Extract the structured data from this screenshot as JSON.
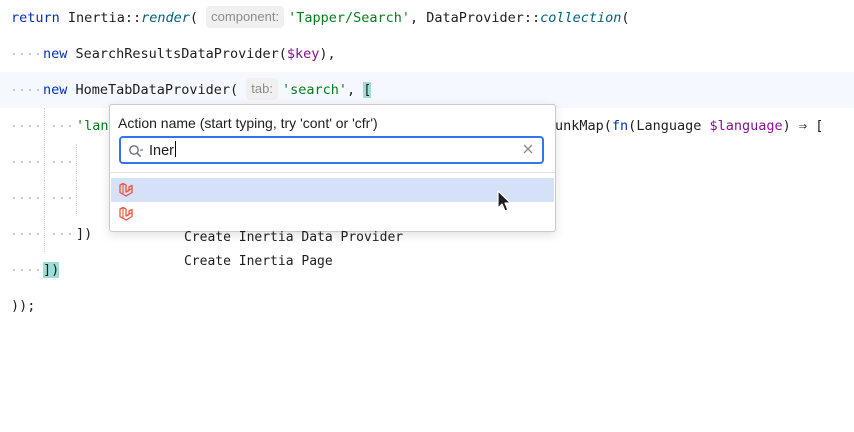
{
  "editor": {
    "line1": {
      "kw_return": "return",
      "class_inertia": "Inertia",
      "op1": "::",
      "fn_render": "render",
      "paren_open": "(",
      "hint_component": "component:",
      "str_tapper": "'Tapper/Search'",
      "comma": ",",
      "class_dataprovider": "DataProvider",
      "op2": "::",
      "fn_collection": "collection",
      "paren_open2": "("
    },
    "line2": {
      "kw_new": "new",
      "class": "SearchResultsDataProvider",
      "paren_open": "(",
      "var": "$key",
      "paren_close": "),"
    },
    "line3": {
      "kw_new": "new",
      "class": "HomeTabDataProvider",
      "paren_open": "(",
      "hint_tab": "tab:",
      "str_search": "'search'",
      "comma": ",",
      "bracket": "["
    },
    "line4": {
      "str_partial": "'lang",
      "tail_fn": "unkMap(",
      "tail_kw_fn": "fn",
      "tail_paren": "(",
      "tail_type": "Language",
      "tail_var": "$language",
      "tail_paren_close": ")",
      "tail_arrow": "⇒",
      "tail_bracket": "["
    },
    "line7": {
      "text": "])"
    },
    "line8": {
      "text": "])"
    },
    "line9": {
      "text": "));"
    }
  },
  "popup": {
    "title": "Action name (start typing, try 'cont' or 'cfr')",
    "search_value": "Iner",
    "results": [
      {
        "label": "Create Inertia Data Provider",
        "icon": "laravel-icon",
        "selected": true
      },
      {
        "label": "Create Inertia Page",
        "icon": "laravel-icon",
        "selected": false
      }
    ]
  },
  "colors": {
    "keyword": "#0033b3",
    "string": "#067d17",
    "variable": "#871094",
    "function": "#00627a",
    "selection": "#d5e1f7",
    "focus_border": "#3574f0",
    "laravel_red": "#f05340",
    "bracket_match": "#9edcd6"
  }
}
